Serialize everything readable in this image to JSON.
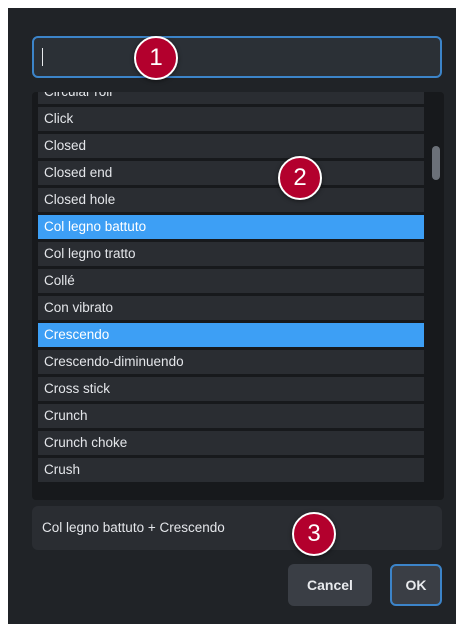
{
  "search": {
    "value": "",
    "placeholder": ""
  },
  "list": {
    "items": [
      {
        "label": "Circular roll",
        "selected": false
      },
      {
        "label": "Click",
        "selected": false
      },
      {
        "label": "Closed",
        "selected": false
      },
      {
        "label": "Closed end",
        "selected": false
      },
      {
        "label": "Closed hole",
        "selected": false
      },
      {
        "label": "Col legno battuto",
        "selected": true
      },
      {
        "label": "Col legno tratto",
        "selected": false
      },
      {
        "label": "Collé",
        "selected": false
      },
      {
        "label": "Con vibrato",
        "selected": false
      },
      {
        "label": "Crescendo",
        "selected": true
      },
      {
        "label": "Crescendo-diminuendo",
        "selected": false
      },
      {
        "label": "Cross stick",
        "selected": false
      },
      {
        "label": "Crunch",
        "selected": false
      },
      {
        "label": "Crunch choke",
        "selected": false
      },
      {
        "label": "Crush",
        "selected": false
      }
    ]
  },
  "summary": {
    "text": "Col legno battuto + Crescendo"
  },
  "buttons": {
    "cancel_label": "Cancel",
    "ok_label": "OK"
  },
  "callouts": {
    "one": "1",
    "two": "2",
    "three": "3"
  },
  "colors": {
    "dialog_bg": "#202327",
    "accent": "#3c84c9",
    "selection": "#3d9ff5",
    "callout": "#b3002d"
  }
}
